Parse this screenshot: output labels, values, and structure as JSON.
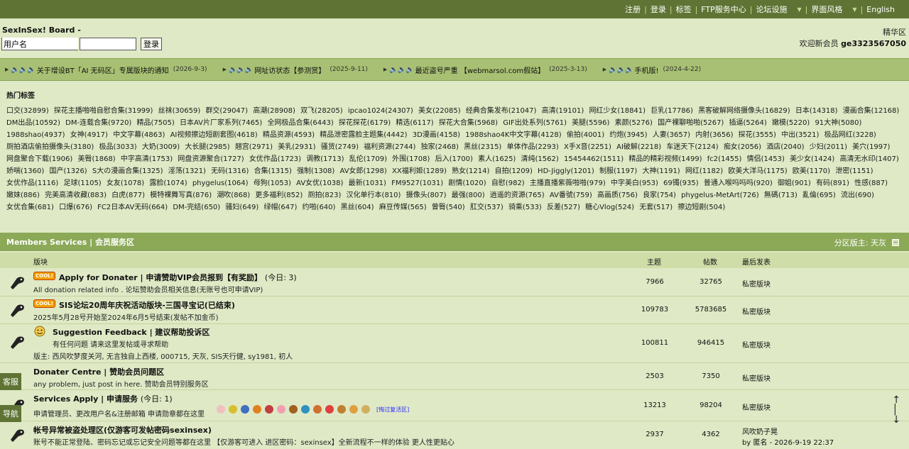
{
  "topnav": {
    "items": [
      {
        "label": "注册",
        "dropdown": false
      },
      {
        "label": "登录",
        "dropdown": false
      },
      {
        "label": "标签",
        "dropdown": false
      },
      {
        "label": "FTP服务中心",
        "dropdown": false
      },
      {
        "label": "论坛设施",
        "dropdown": true
      },
      {
        "label": "界面风格",
        "dropdown": true
      },
      {
        "label": "English",
        "dropdown": false
      }
    ]
  },
  "header": {
    "brand": "SexInSex! Board -",
    "username_placeholder": "用户名",
    "login_label": "登录",
    "jinghua": "精华区",
    "welcome_prefix": "欢迎新会员",
    "welcome_user": "ge3323567050"
  },
  "announcements": [
    {
      "title": "关于增设BT「AI 无码区」专属版块的通知",
      "date": "(2026-9-3)"
    },
    {
      "title": "网址访状态【参测赏】",
      "date": "(2025-9-11)"
    },
    {
      "title": "最近盗号严重 【webmarsol.com假站】",
      "date": "(2025-3-13)"
    },
    {
      "title": "手机版!",
      "date": "(2024-4-22)"
    }
  ],
  "tags": {
    "title": "热门标签",
    "items": [
      "口交(32899)",
      "探花主播啪啪自慰合集(31999)",
      "丝袜(30659)",
      "群交(29047)",
      "高潮(28908)",
      "双飞(28205)",
      "ipcao1024(24307)",
      "美女(22085)",
      "经典合集发布(21047)",
      "高清(19101)",
      "网红少女(18841)",
      "巨乳(17786)",
      "黑客破解网络摄像头(16829)",
      "日本(14318)",
      "漫画合集(12168)",
      "DM出品(10592)",
      "DM-连载合集(9720)",
      "精品(7505)",
      "日本AV片厂家系列(7465)",
      "全网极品合集(6443)",
      "探花探花(6179)",
      "精选(6117)",
      "探花大合集(5968)",
      "GIF出处系列(5761)",
      "美腿(5596)",
      "素颜(5276)",
      "国产裸聊啪啪(5267)",
      "插逼(5264)",
      "嫩模(5220)",
      "91大神(5080)",
      "1988shao(4937)",
      "女神(4917)",
      "中文字幕(4863)",
      "AI视频擦边短剧套图(4618)",
      "精品资源(4593)",
      "精品泄密露脸主题集(4442)",
      "3D漫画(4158)",
      "1988shao4K中文字幕(4128)",
      "偷拍(4001)",
      "约炮(3945)",
      "人妻(3657)",
      "内射(3656)",
      "探花(3555)",
      "中出(3521)",
      "极品网红(3228)",
      "厕拍酒店偷拍摄像头(3180)",
      "极品(3033)",
      "大奶(3009)",
      "大长腿(2985)",
      "翘宫(2971)",
      "美乳(2931)",
      "骚货(2749)",
      "福利资源(2744)",
      "独家(2468)",
      "黑丝(2315)",
      "单体作品(2293)",
      "X手X音(2251)",
      "AI破解(2218)",
      "车迷天下(2124)",
      "痴女(2056)",
      "酒店(2040)",
      "少妇(2011)",
      "美穴(1997)",
      "网盘聚合下载(1906)",
      "美臀(1868)",
      "中字高清(1753)",
      "网盘资源聚合(1727)",
      "女优作品(1723)",
      "调教(1713)",
      "乱伦(1709)",
      "外围(1708)",
      "后入(1700)",
      "素人(1625)",
      "清纯(1562)",
      "15454462(1511)",
      "精品的精彩视频(1499)",
      "fc2(1455)",
      "情侣(1453)",
      "美少女(1424)",
      "高清无水印(1407)",
      "娇喘(1360)",
      "国产(1326)",
      "S大の漫画合集(1325)",
      "淫荡(1321)",
      "无码(1316)",
      "合集(1315)",
      "强制(1308)",
      "AV女郎(1298)",
      "XX福利姬(1289)",
      "熟女(1214)",
      "自拍(1209)",
      "HD-Jiggly(1201)",
      "制服(1197)",
      "大神(1191)",
      "网红(1182)",
      "欧美大洋马(1175)",
      "欧美(1170)",
      "泄密(1151)",
      "女优作品(1116)",
      "足球(1105)",
      "女友(1078)",
      "露脸(1074)",
      "phygelus(1064)",
      "母狗(1053)",
      "AV女优(1038)",
      "最新(1031)",
      "FM9527(1031)",
      "剧情(1020)",
      "自慰(982)",
      "主播直播紫薇啪啪(979)",
      "中字美白(953)",
      "69镯(935)",
      "普通入喉吗吗吗(920)",
      "御姐(901)",
      "有码(891)",
      "性感(887)",
      "嫩妹(886)",
      "完美高清收藏(883)",
      "白虎(877)",
      "模特裸舞写真(876)",
      "潮吹(868)",
      "更多福利(852)",
      "厕拍(823)",
      "汉化单行本(810)",
      "摄像头(807)",
      "最强(800)",
      "逍遥的资源(765)",
      "AV番號(759)",
      "高画质(756)",
      "良家(754)",
      "phygelus-MetArt(726)",
      "無碼(713)",
      "亂倫(695)",
      "流出(690)",
      "女优合集(681)",
      "口爆(676)",
      "FC2日本AV无码(664)",
      "DM-完结(650)",
      "骚妇(649)",
      "绿帽(647)",
      "约啪(640)",
      "黑丝(604)",
      "麻豆传媒(565)",
      "曾臀(540)",
      "肛交(537)",
      "骑乘(533)",
      "反差(527)",
      "糖心Vlog(524)",
      "无套(517)",
      "擦边短剧(504)"
    ]
  },
  "section": {
    "title": "Members Services | 会员服务区",
    "moderator_label": "分区版主: 天灰"
  },
  "columns": {
    "forum": "版块",
    "topics": "主题",
    "posts": "帖数",
    "last": "最后发表"
  },
  "forums": [
    {
      "name": "Apply for Donater | 申请赞助VIP会员报到【有奖励】",
      "today": "(今日: 3)",
      "desc": "All donation related info . 论坛赞助会员相关信息(无账号也可申请VIP)",
      "topics": "7966",
      "posts": "32765",
      "last": "私密版块",
      "badge": "COOL!"
    },
    {
      "name": "SIS论坛20周年庆祝活动版块-三国寻宝记(已结束)",
      "today": "",
      "desc": "2025年5月28号开始至2024年6月5号结束(发帖不加金币)",
      "topics": "109783",
      "posts": "5783685",
      "last": "私密版块",
      "badge": "COOL!"
    },
    {
      "name": "Suggestion Feedback | 建议帮助投诉区",
      "today": "",
      "desc": "有任何问题 请来这里发帖或寻求帮助",
      "desc2": "版主: 西风吹梦度关河, 无言独自上西楼, 000715, 天灰, SIS天行健, sy1981, 初人",
      "topics": "100811",
      "posts": "946415",
      "last": "私密版块",
      "badge": ""
    },
    {
      "name": "Donater Centre | 赞助会员问题区",
      "today": "",
      "desc": "any problem, just post in here.   赞助会员特别服务区",
      "topics": "2503",
      "posts": "7350",
      "last": "私密版块",
      "badge": ""
    },
    {
      "name": "Services Apply | 申请服务",
      "today": "(今日: 1)",
      "desc": "申请管理员、更改用户名&注册邮箱  申请勋章都在这里",
      "medals_more": "[悔过复活区]",
      "topics": "13213",
      "posts": "98204",
      "last": "私密版块",
      "badge": ""
    },
    {
      "name": "帐号异常被盗处理区(仅游客可发帖密码sexinsex)",
      "today": "",
      "desc": "账号不能正常登陆、密码忘记或忘记安全问题等都在这里 【仅游客可进入 进区密码：sexinsex】全新流程不一样的体验 更人性更贴心",
      "topics": "2937",
      "posts": "4362",
      "last": "风吹奶子晃",
      "last2": "by 匿名 - 2026-9-19 22:37",
      "badge": ""
    }
  ],
  "side_buttons": {
    "service": "客服",
    "nav": "导航"
  },
  "colors": {
    "topbar": "#5f7434",
    "background": "#dfe9c5",
    "announce": "#a8c073",
    "section": "#8ba957"
  }
}
